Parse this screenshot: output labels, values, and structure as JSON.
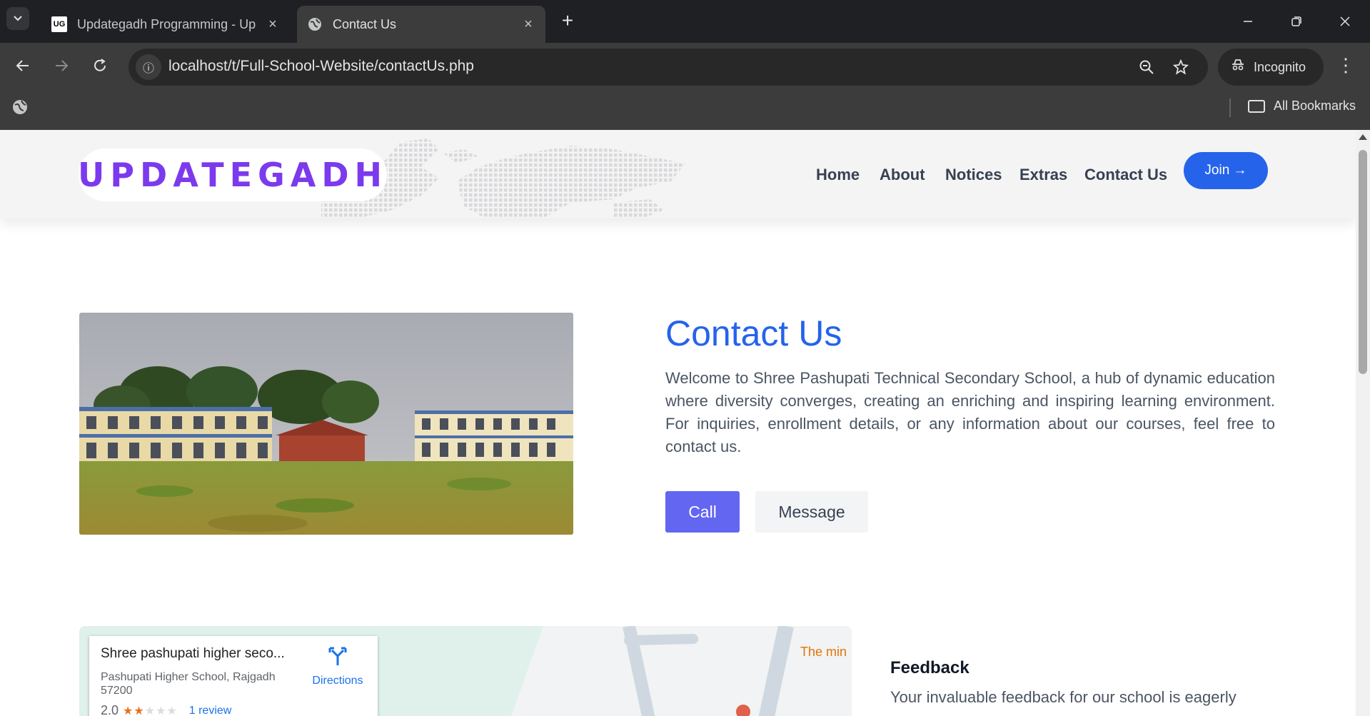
{
  "browser": {
    "tabs": [
      {
        "label": "Updategadh Programming - Up",
        "favicon": "ug-logo",
        "active": false
      },
      {
        "label": "Contact Us",
        "favicon": "globe-icon",
        "active": true
      }
    ],
    "url": "localhost/t/Full-School-Website/contactUs.php",
    "profile_label": "Incognito",
    "bookmarks_label": "All Bookmarks"
  },
  "site": {
    "logo": "UPDATEGADH",
    "nav": [
      "Home",
      "About",
      "Notices",
      "Extras",
      "Contact Us"
    ],
    "join_label": "Join →",
    "accent": "#2563eb",
    "logo_color": "#7c3aed"
  },
  "contact": {
    "title": "Contact Us",
    "text": "Welcome to Shree Pashupati Technical Secondary School, a hub of dynamic education where diversity converges, creating an enriching and inspiring learning environment. For inquiries, enrollment details, or any information about our courses, feel free to contact us.",
    "call_label": "Call",
    "message_label": "Message",
    "call_color": "#6366f1"
  },
  "map": {
    "place_name": "Shree pashupati higher seco...",
    "address": "Pashupati Higher School, Rajgadh 57200",
    "rating": "2.0",
    "stars_filled": 2,
    "stars_total": 5,
    "review_link": "1 review",
    "directions_label": "Directions",
    "nearby_label": "The min"
  },
  "feedback": {
    "title": "Feedback",
    "text": "Your invaluable feedback for our school is eagerly"
  }
}
